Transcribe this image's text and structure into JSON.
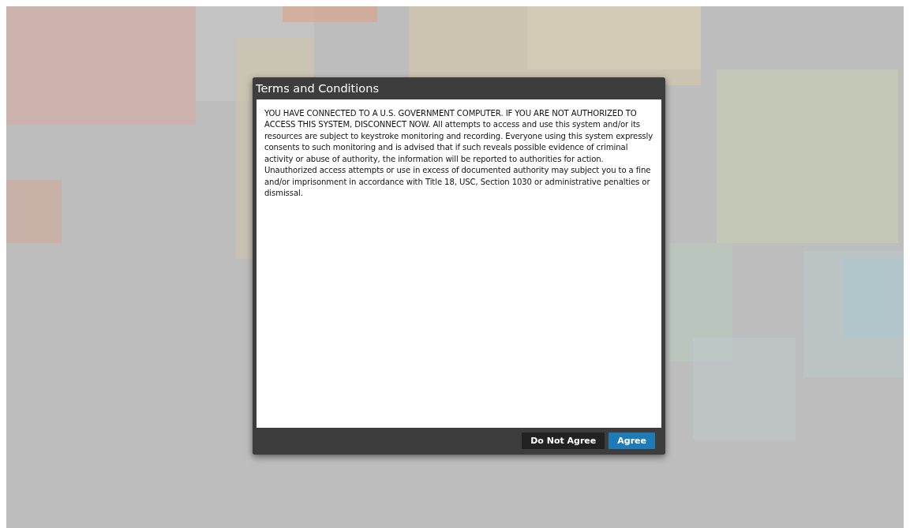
{
  "dialog": {
    "title": "Terms and Conditions",
    "message": "YOU HAVE CONNECTED TO A U.S. GOVERNMENT COMPUTER. IF YOU ARE NOT AUTHORIZED TO ACCESS THIS SYSTEM, DISCONNECT NOW. All attempts to access and use this system and/or its resources are subject to keystroke monitoring and recording. Everyone using this system expressly consents to such monitoring and is advised that if such reveals possible evidence of criminal activity or abuse of authority, the information will be reported to authorities for action. Unauthorized access attempts or use in excess of documented authority may subject you to a fine and/or imprisonment in accordance with Title 18, USC, Section 1030 or administrative penalties or dismissal.",
    "buttons": [
      {
        "label": "Do Not Agree",
        "kind": "secondary"
      },
      {
        "label": "Agree",
        "kind": "primary"
      }
    ]
  }
}
